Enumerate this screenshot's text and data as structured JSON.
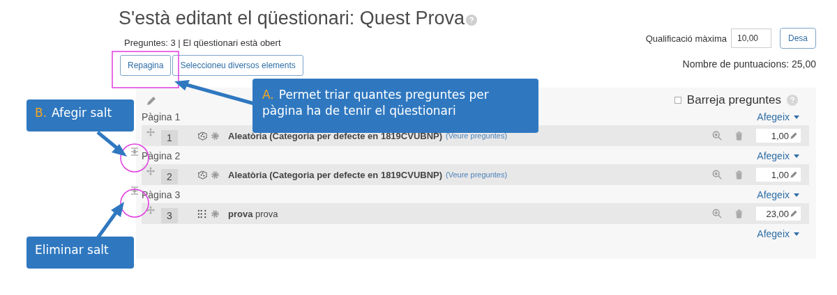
{
  "title": "S'està editant el qüestionari: Quest Prova",
  "summary": "Preguntes: 3 | El qüestionari està obert",
  "max_grade": {
    "label": "Qualificació màxima",
    "value": "10,00",
    "button": "Desa"
  },
  "total": "Nombre de puntuacions: 25,00",
  "toolbar": [
    {
      "label": "Repagina"
    },
    {
      "label": "Seleccioneu diversos elements"
    }
  ],
  "shuffle": {
    "label": "Barreja preguntes",
    "checked": false
  },
  "pages": [
    {
      "label": "Pàgina 1",
      "add": "Afegeix",
      "questions": [
        {
          "number": "1",
          "kind": "random",
          "name": "Aleatòria (Categoria per defecte en 1819CVUBNP)",
          "link": "(Veure preguntes)",
          "mark": "1,00"
        }
      ]
    },
    {
      "label": "Pàgina 2",
      "add": "Afegeix",
      "questions": [
        {
          "number": "2",
          "kind": "random",
          "name": "Aleatòria (Categoria per defecte en 1819CVUBNP)",
          "link": "(Veure preguntes)",
          "mark": "1,00"
        }
      ]
    },
    {
      "label": "Pàgina 3",
      "add": "Afegeix",
      "questions": [
        {
          "number": "3",
          "kind": "multichoice",
          "name": "**prova** prova",
          "mark": "23,00"
        }
      ]
    }
  ],
  "final_add": "Afegeix",
  "callouts": [
    {
      "letter": "B.",
      "text": "Afegir salt"
    },
    {
      "letter": "A.",
      "text": "Permet triar quantes preguntes per pàgina ha de tenir el qüestionari"
    },
    {
      "text": "Eliminar salt"
    }
  ]
}
